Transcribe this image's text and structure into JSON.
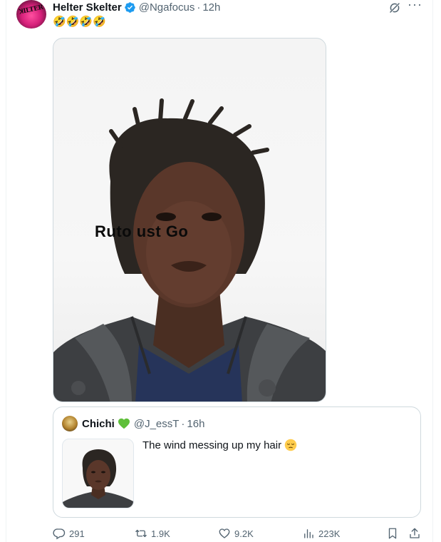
{
  "tweet": {
    "author": {
      "display_name": "Helter Skelter",
      "handle": "@Ngafocus",
      "timestamp": "12h",
      "verified": true,
      "avatar_icon": "avatar-image"
    },
    "text": "🤣🤣🤣🤣",
    "media": {
      "overlay_caption": "Ruto ust Go"
    },
    "quoted": {
      "display_name": "Chichi",
      "name_emoji": "green-heart-icon",
      "handle": "@J_essT",
      "timestamp": "16h",
      "text": "The wind messing up my hair",
      "text_emoji": "pensive-face-emoji"
    },
    "metrics": {
      "replies": "291",
      "retweets": "1.9K",
      "likes": "9.2K",
      "views": "223K"
    }
  },
  "colors": {
    "text_primary": "#0f1419",
    "text_secondary": "#536471",
    "border": "#cfd9de",
    "verified_blue": "#1d9bf0",
    "heart_green": "#5fbf3a"
  }
}
